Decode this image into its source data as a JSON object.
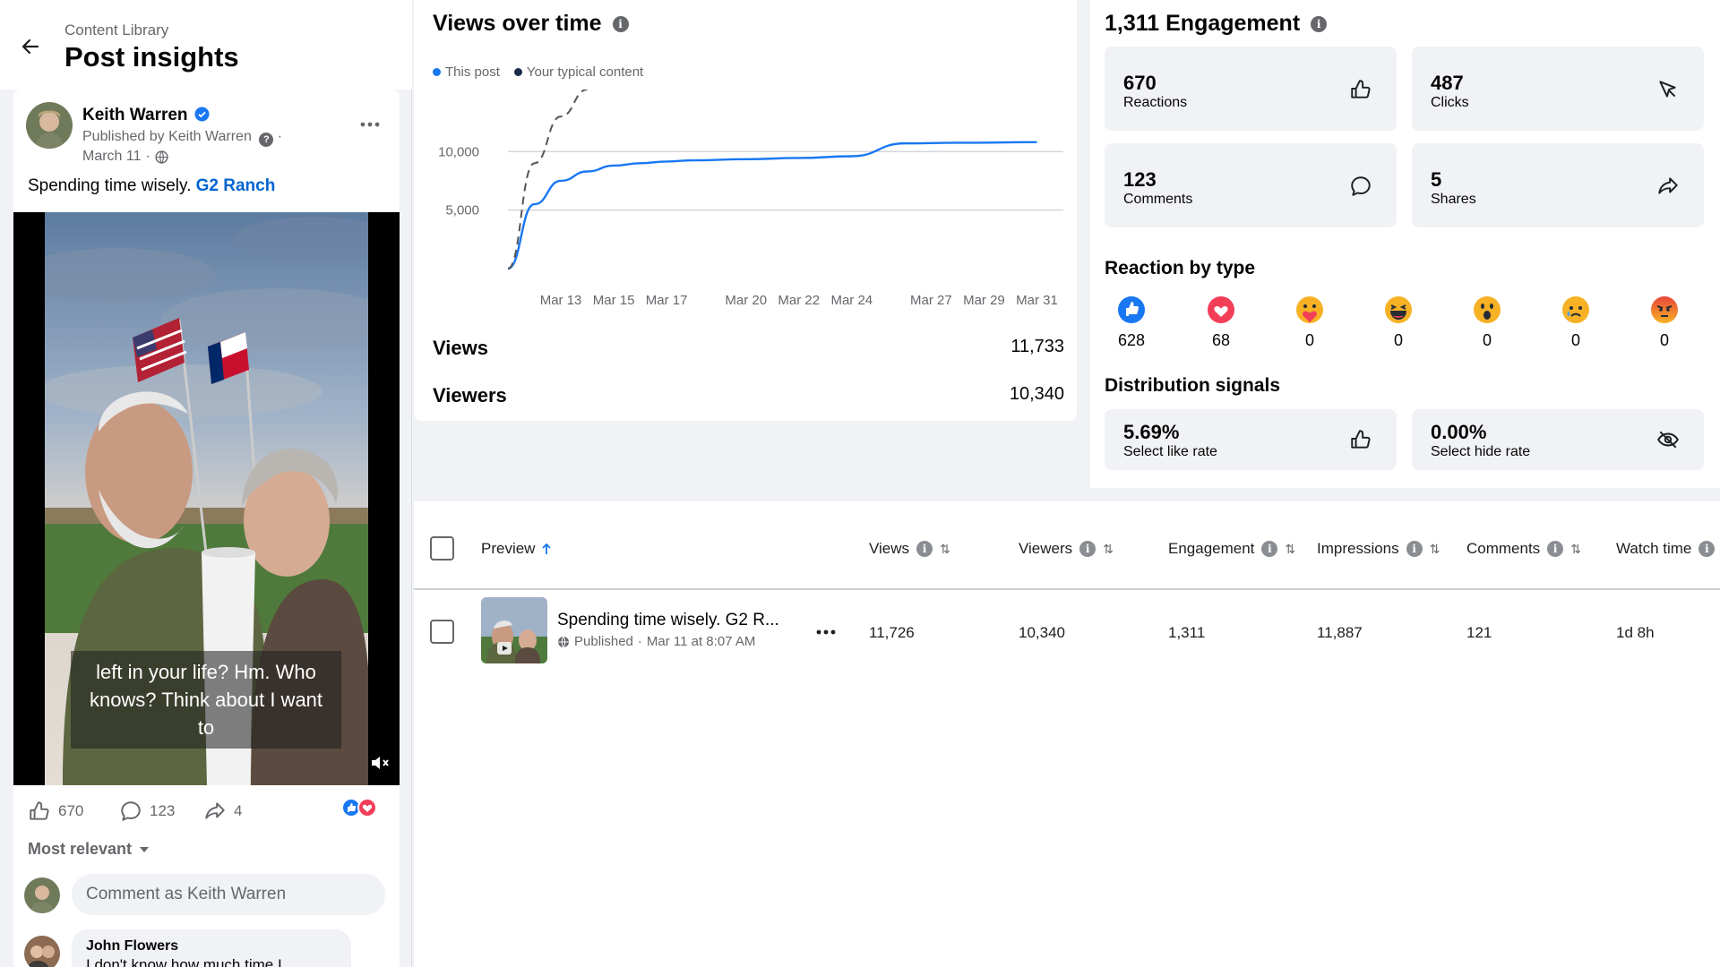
{
  "header": {
    "breadcrumb": "Content Library",
    "title": "Post insights"
  },
  "post": {
    "author": "Keith Warren",
    "published_prefix": "Published by",
    "published_by": "Keith Warren",
    "date": "March 11",
    "text": "Spending time wisely.",
    "tag": "G2 Ranch",
    "caption": "left in your life? Hm. Who knows? Think about I want to",
    "likes": "670",
    "comments": "123",
    "shares": "4",
    "sort_label": "Most relevant",
    "comment_placeholder": "Comment as Keith Warren",
    "first_comment": {
      "author": "John Flowers",
      "text": "I don't know how much time I"
    }
  },
  "views_panel": {
    "title": "Views over time",
    "legend": [
      "This post",
      "Your typical content"
    ],
    "metrics": [
      {
        "label": "Views",
        "value": "11,733"
      },
      {
        "label": "Viewers",
        "value": "10,340"
      }
    ]
  },
  "chart_data": {
    "type": "line",
    "title": "Views over time",
    "x_ticks": [
      "Mar 13",
      "Mar 15",
      "Mar 17",
      "Mar 20",
      "Mar 22",
      "Mar 24",
      "Mar 27",
      "Mar 29",
      "Mar 31"
    ],
    "y_ticks": [
      "10,000",
      "5,000"
    ],
    "grid": true,
    "legend_position": "top-left",
    "series": [
      {
        "name": "This post",
        "color": "#1877f2",
        "style": "solid",
        "points": [
          [
            "Mar 11",
            0
          ],
          [
            "Mar 12",
            5500
          ],
          [
            "Mar 13",
            7500
          ],
          [
            "Mar 14",
            8300
          ],
          [
            "Mar 15",
            8800
          ],
          [
            "Mar 16",
            9000
          ],
          [
            "Mar 17",
            9150
          ],
          [
            "Mar 18",
            9250
          ],
          [
            "Mar 20",
            9350
          ],
          [
            "Mar 22",
            9450
          ],
          [
            "Mar 24",
            9600
          ],
          [
            "Mar 26",
            10700
          ],
          [
            "Mar 28",
            10750
          ],
          [
            "Mar 31",
            10800
          ]
        ]
      },
      {
        "name": "Your typical content",
        "color": "#555555",
        "style": "dashed",
        "points": [
          [
            "Mar 11",
            0
          ],
          [
            "Mar 12",
            9000
          ],
          [
            "Mar 13",
            13000
          ],
          [
            "Mar 14",
            15300
          ]
        ]
      }
    ]
  },
  "engagement": {
    "title": "1,311 Engagement",
    "cards": [
      {
        "value": "670",
        "label": "Reactions",
        "icon": "thumbs-up-icon"
      },
      {
        "value": "487",
        "label": "Clicks",
        "icon": "cursor-icon"
      },
      {
        "value": "123",
        "label": "Comments",
        "icon": "comment-icon"
      },
      {
        "value": "5",
        "label": "Shares",
        "icon": "share-icon"
      }
    ],
    "reaction_title": "Reaction by type",
    "reactions": [
      {
        "name": "like",
        "count": "628",
        "color": "#1877f2"
      },
      {
        "name": "love",
        "count": "68",
        "color": "#f33e58"
      },
      {
        "name": "care",
        "count": "0",
        "color": "#f7b125"
      },
      {
        "name": "haha",
        "count": "0",
        "color": "#f7b125"
      },
      {
        "name": "wow",
        "count": "0",
        "color": "#f7b125"
      },
      {
        "name": "sad",
        "count": "0",
        "color": "#f7b125"
      },
      {
        "name": "angry",
        "count": "0",
        "color": "#e9710f"
      }
    ],
    "distribution_title": "Distribution signals",
    "signals": [
      {
        "value": "5.69%",
        "label": "Select like rate",
        "icon": "thumbs-up-icon"
      },
      {
        "value": "0.00%",
        "label": "Select hide rate",
        "icon": "eye-slash-icon"
      }
    ]
  },
  "table": {
    "headers": [
      "Preview",
      "Views",
      "Viewers",
      "Engagement",
      "Impressions",
      "Comments",
      "Watch time"
    ],
    "row": {
      "title": "Spending time wisely. G2 R...",
      "published": "Published",
      "date": "Mar 11 at 8:07 AM",
      "views": "11,726",
      "viewers": "10,340",
      "engagement": "1,311",
      "impressions": "11,887",
      "comments": "121",
      "watch_time": "1d 8h"
    }
  }
}
